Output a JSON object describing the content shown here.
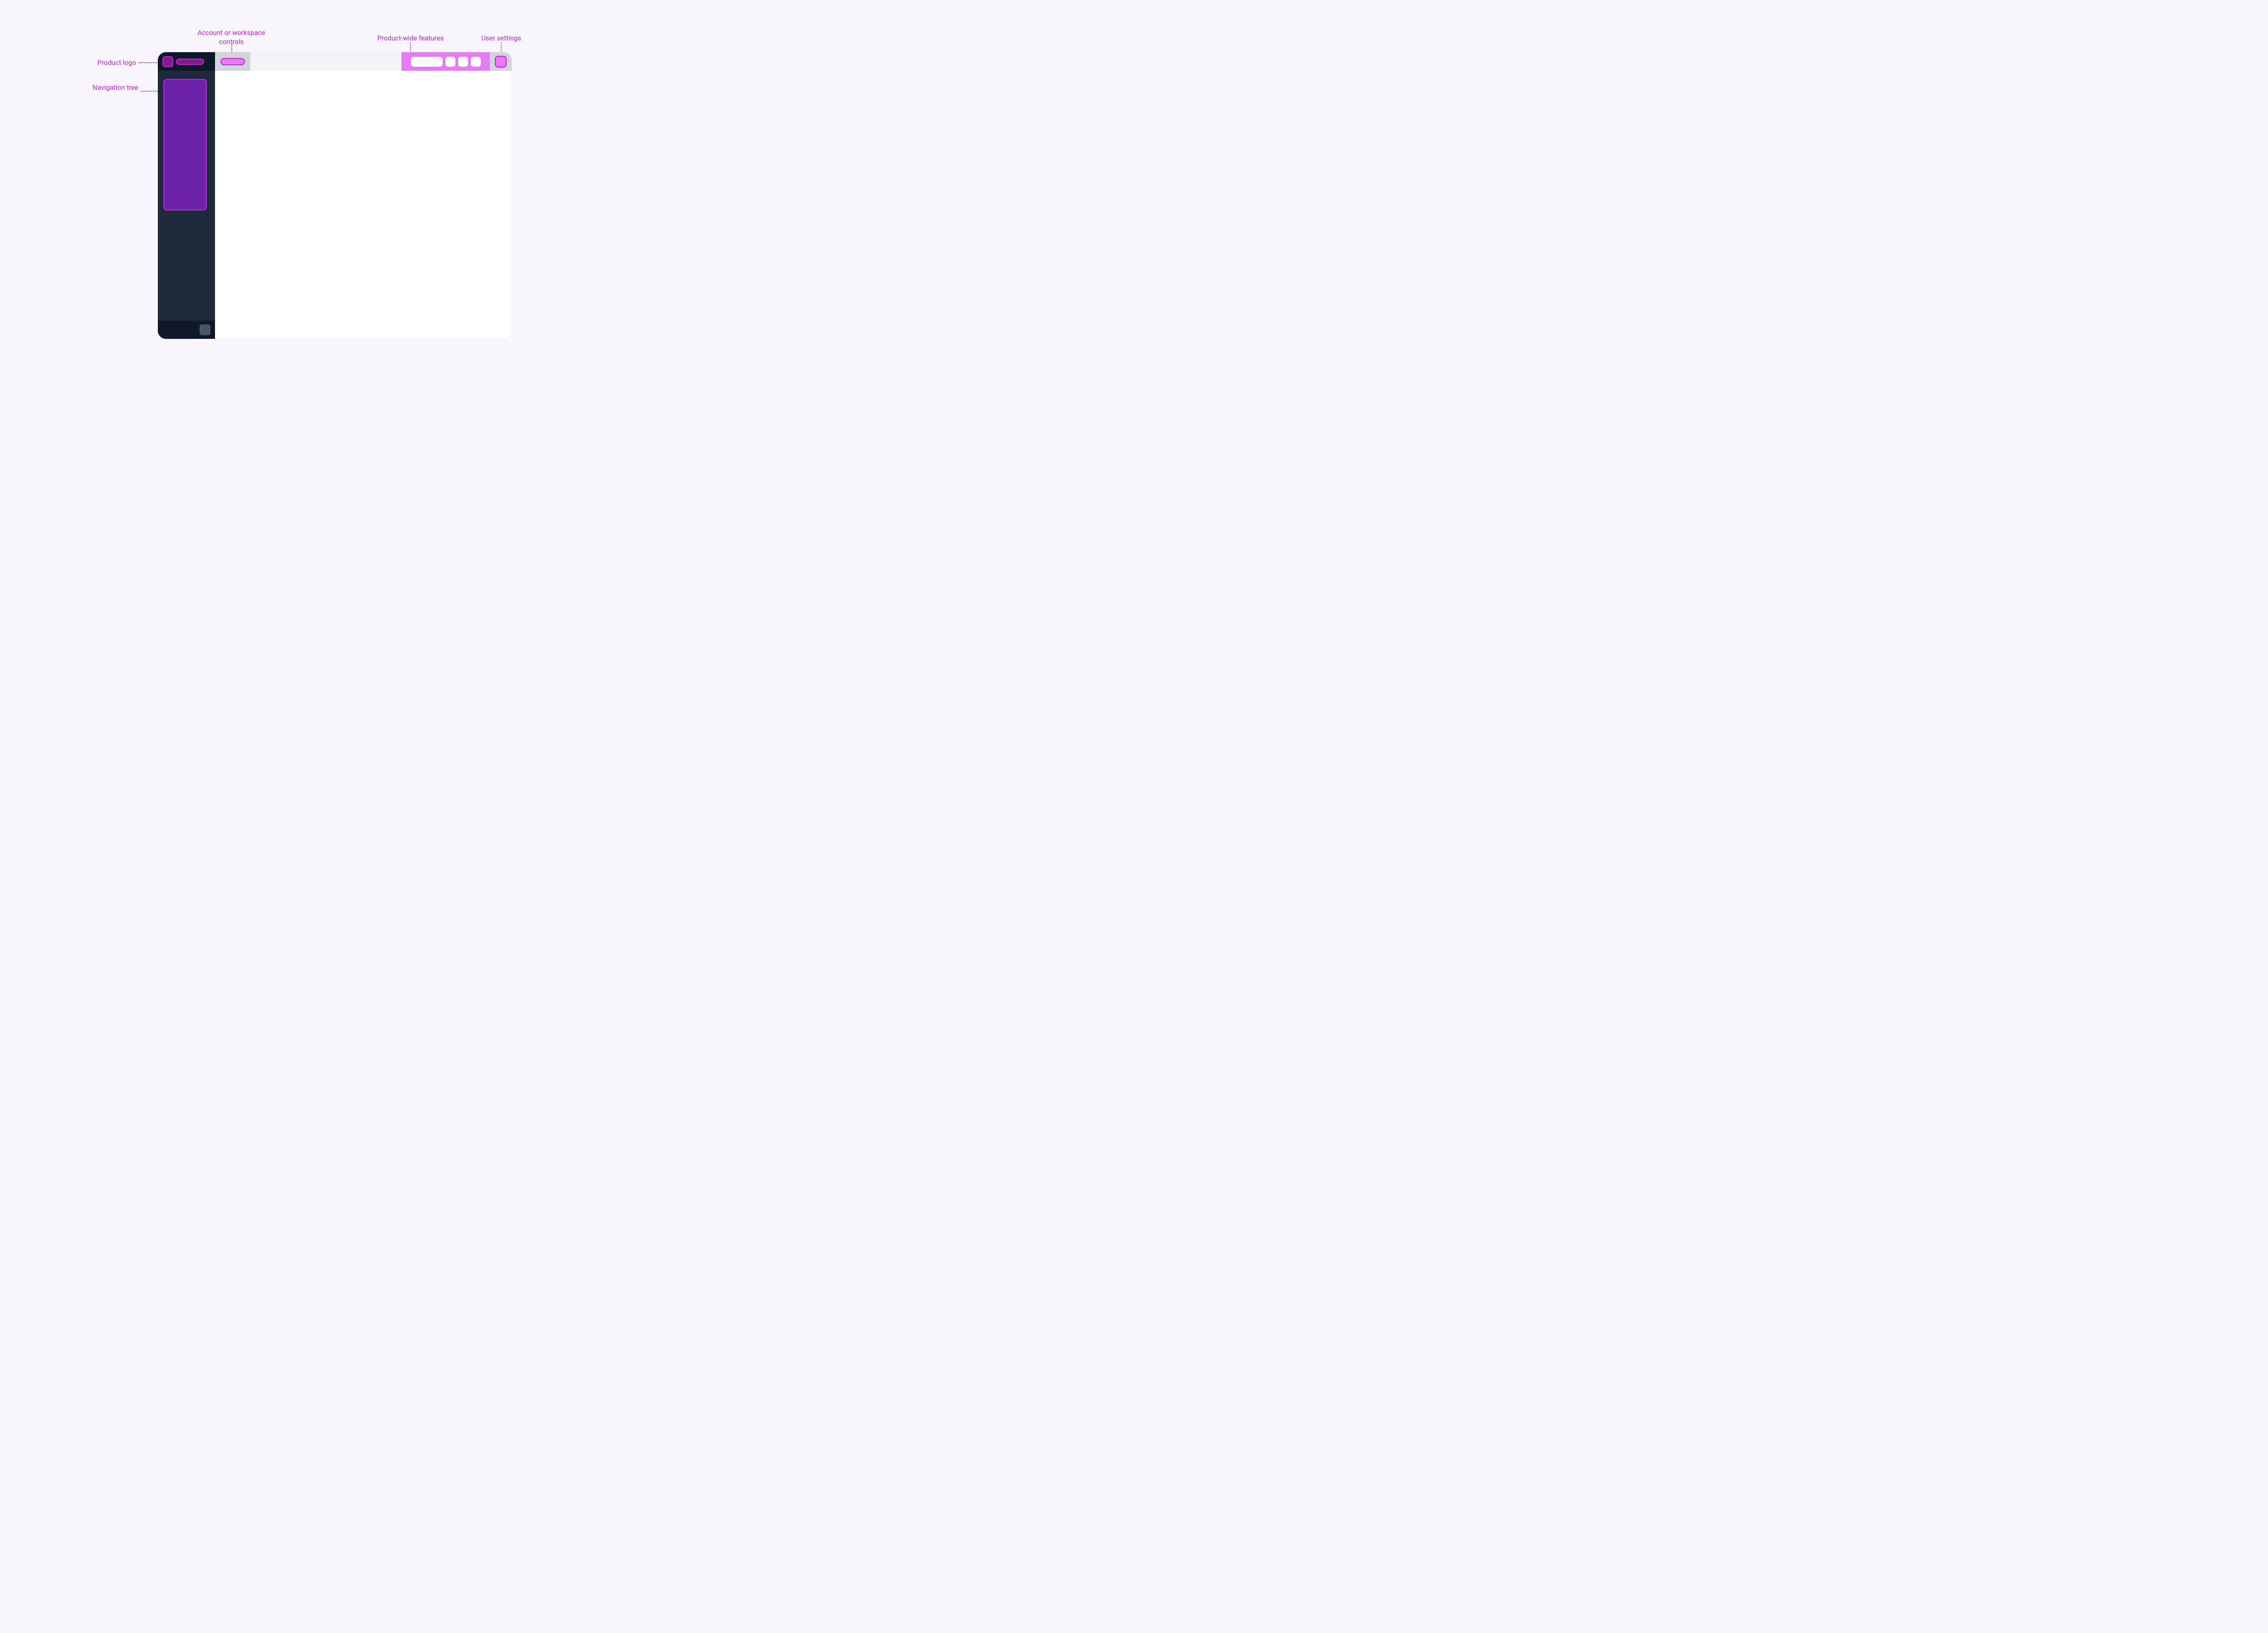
{
  "annotations": {
    "product_logo": "Product logo",
    "account_workspace": "Account or workspace controls",
    "navigation_tree": "Navigation tree",
    "product_features": "Product-wide features",
    "user_settings": "User settings"
  },
  "colors": {
    "page_bg": "#f8f5fd",
    "sidebar_bg": "#1e293b",
    "sidebar_header_footer_bg": "#0f172a",
    "topbar_bg": "#f3f4f6",
    "segment_gray": "#d1d5db",
    "highlight_fill": "#e879f9",
    "highlight_border": "#c026d3",
    "nav_tree_fill": "#6b21a8",
    "logo_fill": "#86198f",
    "footer_square": "#475569",
    "content_bg": "#ffffff",
    "label_text": "#c026d3"
  },
  "layout": {
    "regions": [
      "product-logo",
      "account-workspace-controls",
      "navigation-tree",
      "product-wide-features",
      "user-settings",
      "sidebar-footer-control",
      "main-content"
    ]
  }
}
